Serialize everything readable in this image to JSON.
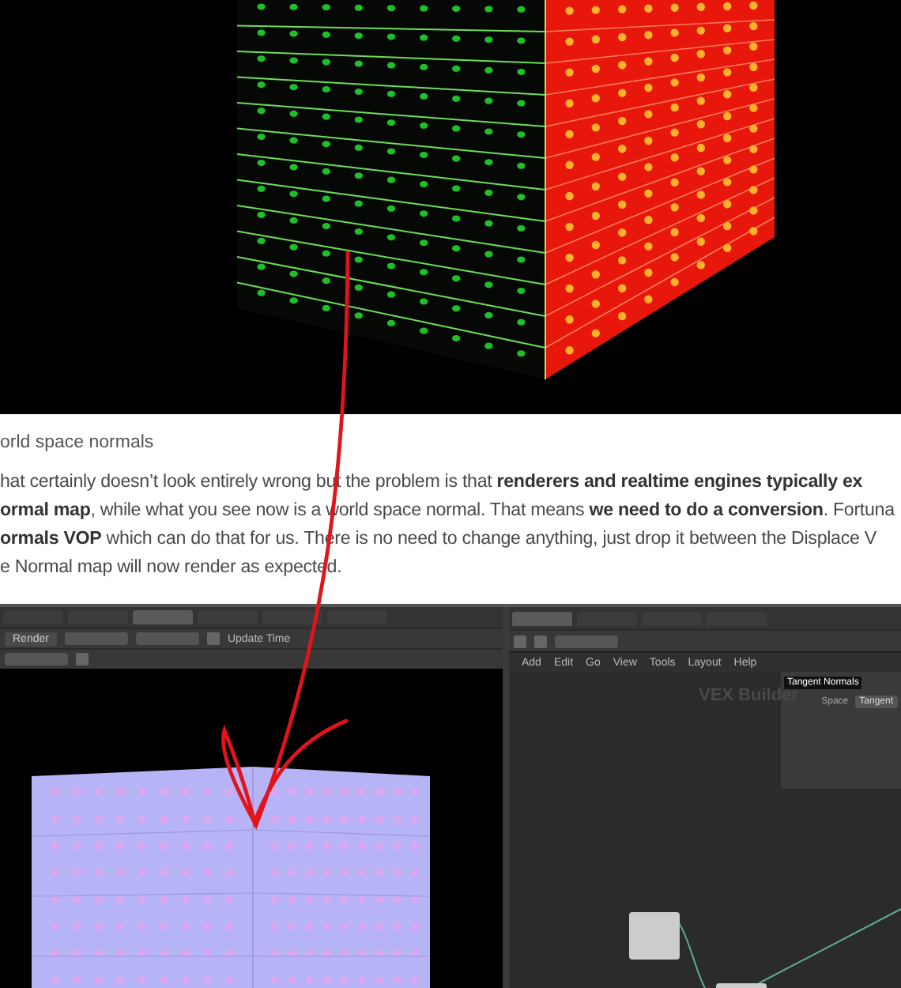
{
  "caption": "orld space normals",
  "paragraph": [
    "hat certainly doesn’t look entirely wrong but the problem is that **renderers and realtime engines typically ex**",
    "**ormal map**, while what you see now is a world space normal. That means **we need to do a conversion**. Fortuna",
    "**ormals VOP** which can do that for us. There is no need to change anything, just drop it between the Displace V",
    "e Normal map will now render as expected."
  ],
  "screenshot": {
    "viewport": {
      "tabs": [
        {
          "selected": false
        },
        {
          "selected": false
        },
        {
          "selected": true
        },
        {
          "selected": false
        },
        {
          "selected": false
        },
        {
          "selected": false
        }
      ],
      "render_button": "Render",
      "update_label": "Update Time"
    },
    "network": {
      "tabs": [
        {
          "selected": true
        },
        {
          "selected": false
        },
        {
          "selected": false
        },
        {
          "selected": false
        }
      ],
      "menu": [
        "Add",
        "Edit",
        "Go",
        "View",
        "Tools",
        "Layout",
        "Help"
      ],
      "context_label": "VEX Builder",
      "parm_tabs": [
        {
          "label": "Tangent Normals",
          "selected": true
        }
      ],
      "parms": [
        {
          "label": "Space",
          "value": "Tangent"
        }
      ]
    }
  }
}
